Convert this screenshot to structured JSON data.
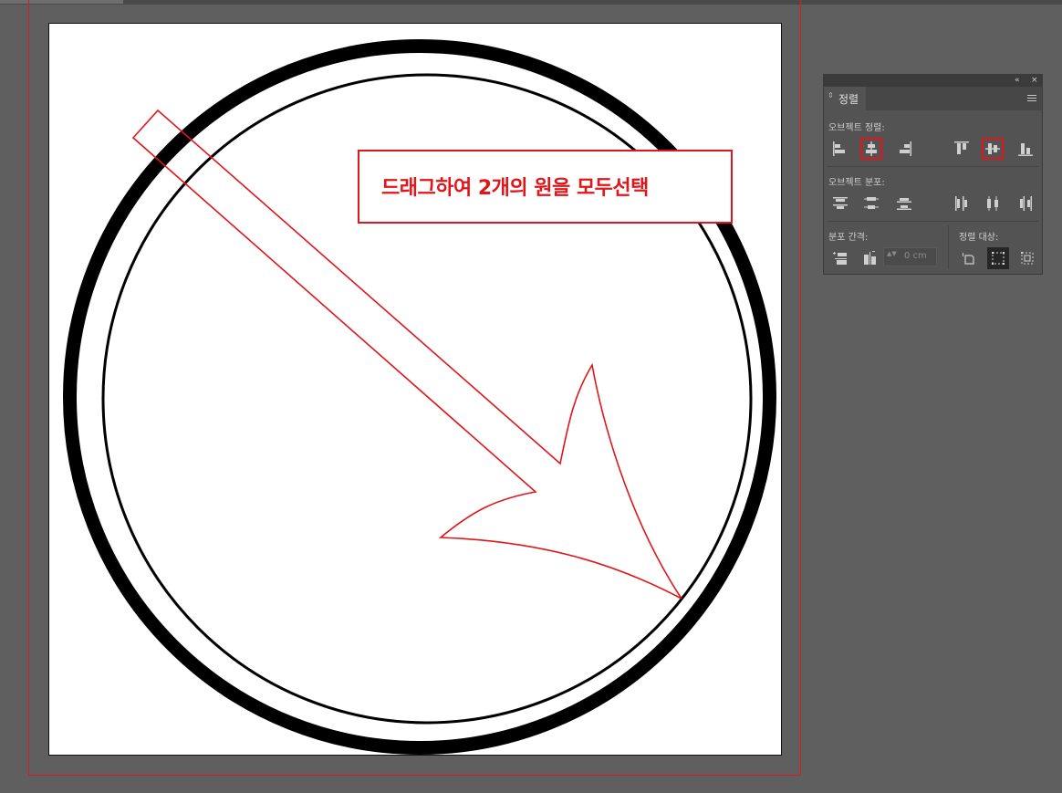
{
  "callout": {
    "text": "드래그하여 2개의 원을 모두선택"
  },
  "panel": {
    "collapse_glyph": "«",
    "close_glyph": "×",
    "tab_arrow_glyph": "⇕",
    "tab_label": "정렬",
    "align_objects_label": "오브젝트 정렬:",
    "distribute_objects_label": "오브젝트 분포:",
    "distribute_spacing_label": "분포 간격:",
    "align_to_label": "정렬 대상:",
    "spacing_value": "0 cm",
    "spin_glyph": "▲▼"
  },
  "icons": {
    "align": [
      "horizontal-align-left-icon",
      "horizontal-align-center-icon",
      "horizontal-align-right-icon",
      "vertical-align-top-icon",
      "vertical-align-center-icon",
      "vertical-align-bottom-icon"
    ],
    "distribute": [
      "vertical-distribute-top-icon",
      "vertical-distribute-center-icon",
      "vertical-distribute-bottom-icon",
      "horizontal-distribute-left-icon",
      "horizontal-distribute-center-icon",
      "horizontal-distribute-right-icon"
    ],
    "spacing": [
      "vertical-distribute-space-icon",
      "horizontal-distribute-space-icon"
    ],
    "align_to": [
      "align-to-key-object-icon",
      "align-to-selection-icon",
      "align-to-artboard-icon"
    ]
  },
  "colors": {
    "annotation_red": "#e0161b",
    "panel_bg": "#535353",
    "canvas_bg": "#5f5f5f"
  }
}
